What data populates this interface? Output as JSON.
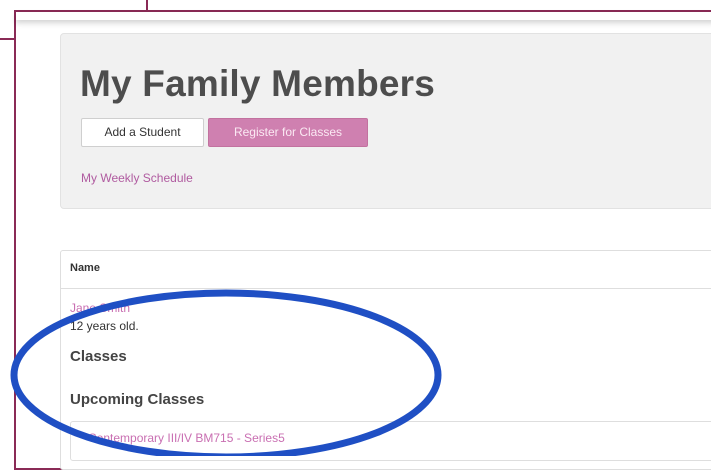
{
  "page": {
    "title": "My Family Members",
    "add_student_label": "Add a Student",
    "register_label": "Register for Classes",
    "weekly_schedule_label": "My Weekly Schedule"
  },
  "table": {
    "columns": [
      "Name"
    ],
    "rows": [
      {
        "name": "Jane Smith",
        "age_text": "12 years old.",
        "classes_heading": "Classes",
        "upcoming_heading": "Upcoming Classes",
        "upcoming_classes": [
          "Contemporary III/IV BM715 - Series5"
        ]
      }
    ]
  },
  "colors": {
    "accent": "#cf80b0",
    "link": "#c96fb2",
    "frame": "#8a2a56",
    "annotation": "#1f4fc4"
  },
  "annotation": {
    "shape": "ellipse",
    "color": "#1f4fc4"
  }
}
